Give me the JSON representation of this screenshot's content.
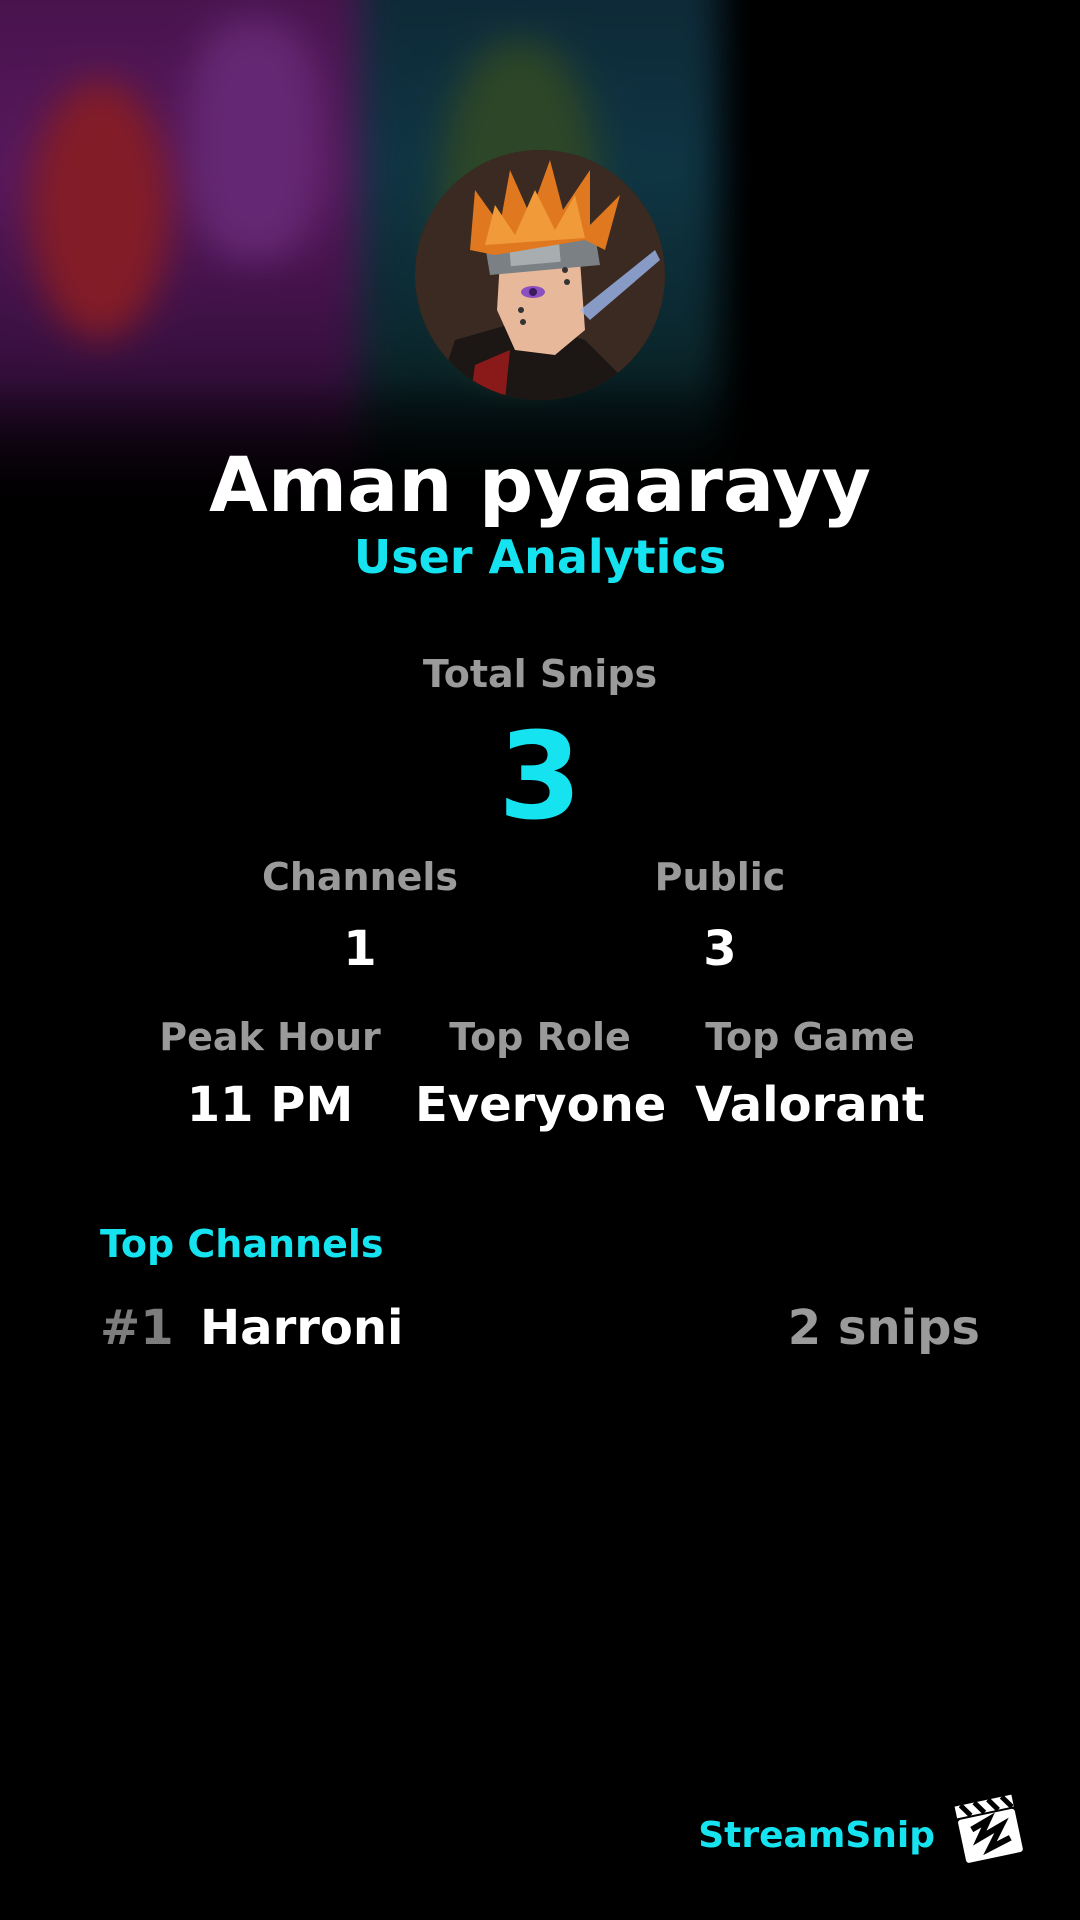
{
  "profile": {
    "name": "Aman pyaarayy",
    "subtitle": "User Analytics"
  },
  "totals": {
    "label": "Total Snips",
    "value": "3"
  },
  "stats_row1": [
    {
      "label": "Channels",
      "value": "1"
    },
    {
      "label": "Public",
      "value": "3"
    }
  ],
  "stats_row2": [
    {
      "label": "Peak Hour",
      "value": "11 PM"
    },
    {
      "label": "Top Role",
      "value": "Everyone"
    },
    {
      "label": "Top Game",
      "value": "Valorant"
    }
  ],
  "top_channels": {
    "title": "Top Channels",
    "items": [
      {
        "rank": "#1",
        "name": "Harroni",
        "count": "2 snips"
      }
    ]
  },
  "brand": {
    "name": "StreamSnip",
    "icon": "clapperboard-logo-icon"
  },
  "colors": {
    "accent": "#16e3f0",
    "background": "#000000",
    "muted": "#9a9a9a"
  }
}
